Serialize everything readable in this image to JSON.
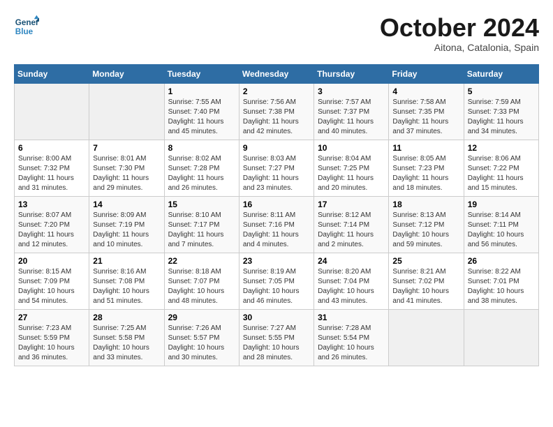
{
  "logo": {
    "line1": "General",
    "line2": "Blue"
  },
  "title": "October 2024",
  "subtitle": "Aitona, Catalonia, Spain",
  "days_of_week": [
    "Sunday",
    "Monday",
    "Tuesday",
    "Wednesday",
    "Thursday",
    "Friday",
    "Saturday"
  ],
  "weeks": [
    [
      {
        "day": "",
        "info": ""
      },
      {
        "day": "",
        "info": ""
      },
      {
        "day": "1",
        "info": "Sunrise: 7:55 AM\nSunset: 7:40 PM\nDaylight: 11 hours and 45 minutes."
      },
      {
        "day": "2",
        "info": "Sunrise: 7:56 AM\nSunset: 7:38 PM\nDaylight: 11 hours and 42 minutes."
      },
      {
        "day": "3",
        "info": "Sunrise: 7:57 AM\nSunset: 7:37 PM\nDaylight: 11 hours and 40 minutes."
      },
      {
        "day": "4",
        "info": "Sunrise: 7:58 AM\nSunset: 7:35 PM\nDaylight: 11 hours and 37 minutes."
      },
      {
        "day": "5",
        "info": "Sunrise: 7:59 AM\nSunset: 7:33 PM\nDaylight: 11 hours and 34 minutes."
      }
    ],
    [
      {
        "day": "6",
        "info": "Sunrise: 8:00 AM\nSunset: 7:32 PM\nDaylight: 11 hours and 31 minutes."
      },
      {
        "day": "7",
        "info": "Sunrise: 8:01 AM\nSunset: 7:30 PM\nDaylight: 11 hours and 29 minutes."
      },
      {
        "day": "8",
        "info": "Sunrise: 8:02 AM\nSunset: 7:28 PM\nDaylight: 11 hours and 26 minutes."
      },
      {
        "day": "9",
        "info": "Sunrise: 8:03 AM\nSunset: 7:27 PM\nDaylight: 11 hours and 23 minutes."
      },
      {
        "day": "10",
        "info": "Sunrise: 8:04 AM\nSunset: 7:25 PM\nDaylight: 11 hours and 20 minutes."
      },
      {
        "day": "11",
        "info": "Sunrise: 8:05 AM\nSunset: 7:23 PM\nDaylight: 11 hours and 18 minutes."
      },
      {
        "day": "12",
        "info": "Sunrise: 8:06 AM\nSunset: 7:22 PM\nDaylight: 11 hours and 15 minutes."
      }
    ],
    [
      {
        "day": "13",
        "info": "Sunrise: 8:07 AM\nSunset: 7:20 PM\nDaylight: 11 hours and 12 minutes."
      },
      {
        "day": "14",
        "info": "Sunrise: 8:09 AM\nSunset: 7:19 PM\nDaylight: 11 hours and 10 minutes."
      },
      {
        "day": "15",
        "info": "Sunrise: 8:10 AM\nSunset: 7:17 PM\nDaylight: 11 hours and 7 minutes."
      },
      {
        "day": "16",
        "info": "Sunrise: 8:11 AM\nSunset: 7:16 PM\nDaylight: 11 hours and 4 minutes."
      },
      {
        "day": "17",
        "info": "Sunrise: 8:12 AM\nSunset: 7:14 PM\nDaylight: 11 hours and 2 minutes."
      },
      {
        "day": "18",
        "info": "Sunrise: 8:13 AM\nSunset: 7:12 PM\nDaylight: 10 hours and 59 minutes."
      },
      {
        "day": "19",
        "info": "Sunrise: 8:14 AM\nSunset: 7:11 PM\nDaylight: 10 hours and 56 minutes."
      }
    ],
    [
      {
        "day": "20",
        "info": "Sunrise: 8:15 AM\nSunset: 7:09 PM\nDaylight: 10 hours and 54 minutes."
      },
      {
        "day": "21",
        "info": "Sunrise: 8:16 AM\nSunset: 7:08 PM\nDaylight: 10 hours and 51 minutes."
      },
      {
        "day": "22",
        "info": "Sunrise: 8:18 AM\nSunset: 7:07 PM\nDaylight: 10 hours and 48 minutes."
      },
      {
        "day": "23",
        "info": "Sunrise: 8:19 AM\nSunset: 7:05 PM\nDaylight: 10 hours and 46 minutes."
      },
      {
        "day": "24",
        "info": "Sunrise: 8:20 AM\nSunset: 7:04 PM\nDaylight: 10 hours and 43 minutes."
      },
      {
        "day": "25",
        "info": "Sunrise: 8:21 AM\nSunset: 7:02 PM\nDaylight: 10 hours and 41 minutes."
      },
      {
        "day": "26",
        "info": "Sunrise: 8:22 AM\nSunset: 7:01 PM\nDaylight: 10 hours and 38 minutes."
      }
    ],
    [
      {
        "day": "27",
        "info": "Sunrise: 7:23 AM\nSunset: 5:59 PM\nDaylight: 10 hours and 36 minutes."
      },
      {
        "day": "28",
        "info": "Sunrise: 7:25 AM\nSunset: 5:58 PM\nDaylight: 10 hours and 33 minutes."
      },
      {
        "day": "29",
        "info": "Sunrise: 7:26 AM\nSunset: 5:57 PM\nDaylight: 10 hours and 30 minutes."
      },
      {
        "day": "30",
        "info": "Sunrise: 7:27 AM\nSunset: 5:55 PM\nDaylight: 10 hours and 28 minutes."
      },
      {
        "day": "31",
        "info": "Sunrise: 7:28 AM\nSunset: 5:54 PM\nDaylight: 10 hours and 26 minutes."
      },
      {
        "day": "",
        "info": ""
      },
      {
        "day": "",
        "info": ""
      }
    ]
  ]
}
